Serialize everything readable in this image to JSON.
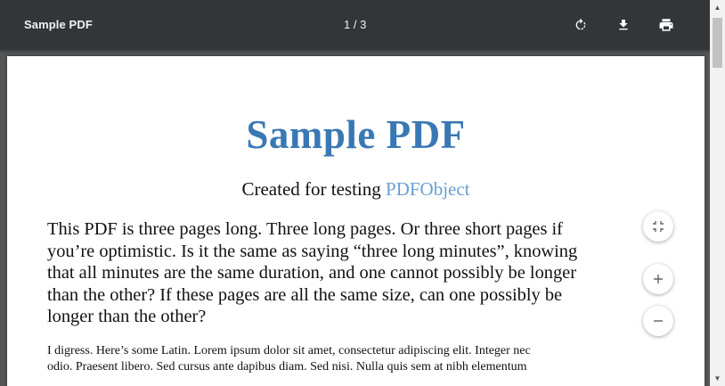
{
  "toolbar": {
    "title": "Sample PDF",
    "page_indicator": "1 / 3",
    "icons": {
      "rotate": "rotate-clockwise-icon",
      "download": "download-icon",
      "print": "print-icon"
    }
  },
  "document": {
    "title": "Sample PDF",
    "subtitle_text": "Created for testing ",
    "subtitle_link": "PDFObject",
    "paragraph1_lines": [
      "This PDF is three pages long. Three long pages. Or three short pages if",
      "you’re optimistic. Is it the same as saying “three long minutes”, knowing",
      "that all minutes are the same duration, and one cannot possibly be longer",
      "than the other? If these pages are all the same size, can one possibly be",
      "longer than the other?"
    ],
    "paragraph2_lines": [
      "I digress. Here’s some Latin. Lorem ipsum dolor sit amet, consectetur adipiscing elit. Integer nec",
      "odio. Praesent libero. Sed cursus ante dapibus diam. Sed nisi. Nulla quis sem at nibh elementum"
    ]
  },
  "zoom": {
    "icons": {
      "fit": "fit-to-page-icon",
      "zoom_in": "zoom-in-icon",
      "zoom_out": "zoom-out-icon"
    }
  },
  "colors": {
    "toolbar_bg": "#323639",
    "viewer_bg": "#525659",
    "title_blue": "#3a78b4",
    "link_blue": "#6a9fd3"
  }
}
